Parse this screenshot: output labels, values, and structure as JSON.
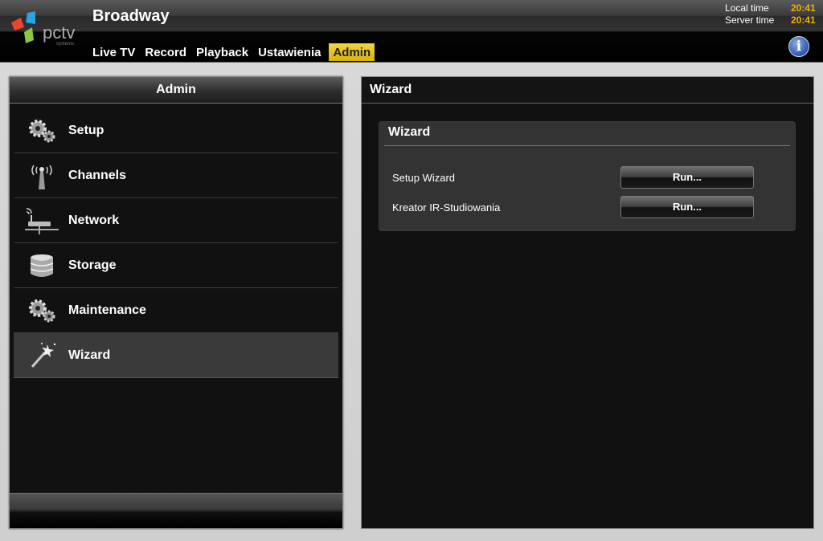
{
  "app": {
    "title": "Broadway",
    "logo_text": "pctv",
    "logo_subtext": "systems"
  },
  "clock": {
    "local_label": "Local time",
    "local_value": "20:41",
    "server_label": "Server time",
    "server_value": "20:41"
  },
  "nav": {
    "items": [
      {
        "label": "Live TV"
      },
      {
        "label": "Record"
      },
      {
        "label": "Playback"
      },
      {
        "label": "Ustawienia"
      },
      {
        "label": "Admin",
        "active": true
      }
    ],
    "info_icon": "info-icon"
  },
  "sidebar": {
    "title": "Admin",
    "items": [
      {
        "label": "Setup",
        "icon": "gears-icon"
      },
      {
        "label": "Channels",
        "icon": "antenna-icon"
      },
      {
        "label": "Network",
        "icon": "router-icon"
      },
      {
        "label": "Storage",
        "icon": "database-icon"
      },
      {
        "label": "Maintenance",
        "icon": "gears-icon"
      },
      {
        "label": "Wizard",
        "icon": "magic-wand-icon",
        "active": true
      }
    ]
  },
  "main": {
    "title": "Wizard",
    "section_title": "Wizard",
    "rows": [
      {
        "label": "Setup Wizard",
        "button": "Run..."
      },
      {
        "label": "Kreator IR-Studiowania",
        "button": "Run..."
      }
    ]
  },
  "colors": {
    "accent_yellow": "#e6c420",
    "time_orange": "#f0b400",
    "logo_red": "#e8452c",
    "logo_blue": "#2aa3e0",
    "logo_green": "#8cc63e"
  }
}
